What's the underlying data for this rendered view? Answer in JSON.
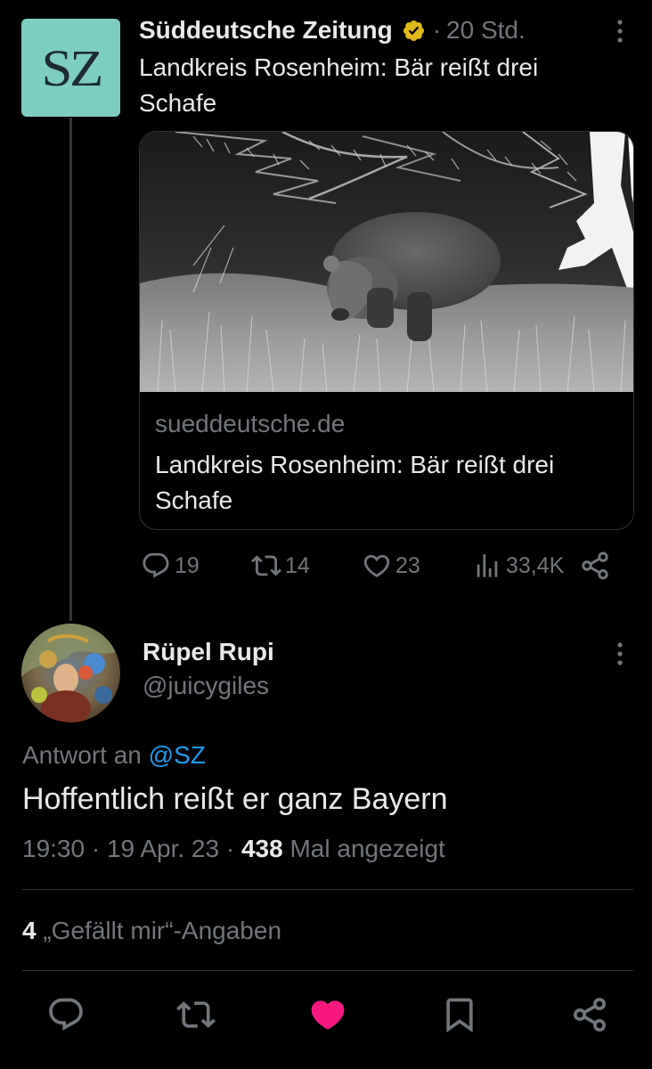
{
  "parent_tweet": {
    "avatar_text": "SZ",
    "author": "Süddeutsche Zeitung",
    "separator": "·",
    "time": "20 Std.",
    "text": "Landkreis Rosenheim: Bär reißt drei Schafe",
    "card": {
      "domain": "sueddeutsche.de",
      "title": "Landkreis Rosenheim: Bär reißt drei Schafe"
    },
    "actions": {
      "replies": "19",
      "retweets": "14",
      "likes": "23",
      "views": "33,4K"
    }
  },
  "reply_tweet": {
    "name": "Rüpel Rupi",
    "handle": "@juicygiles",
    "reply_prefix": "Antwort an",
    "reply_mention": "@SZ",
    "text": "Hoffentlich reißt er ganz Bayern",
    "time": "19:30",
    "sep1": "·",
    "date": "19 Apr. 23",
    "sep2": "·",
    "views_count": "438",
    "views_label": "Mal angezeigt",
    "likes_count": "4",
    "likes_label": "„Gefällt mir“-Angaben"
  },
  "colors": {
    "background": "#000000",
    "text_primary": "#e7e9ea",
    "text_secondary": "#71767b",
    "link": "#1d9bf0",
    "like_active": "#f91880",
    "verified_gold": "#e2b719",
    "sz_brand": "#7ecdc2"
  },
  "icons": {
    "verified": "verified-gold-badge-icon",
    "more": "more-vertical-icon",
    "reply": "reply-bubble-icon",
    "retweet": "retweet-icon",
    "like": "heart-icon",
    "views": "bar-chart-icon",
    "share": "share-icon",
    "bookmark": "bookmark-icon"
  }
}
